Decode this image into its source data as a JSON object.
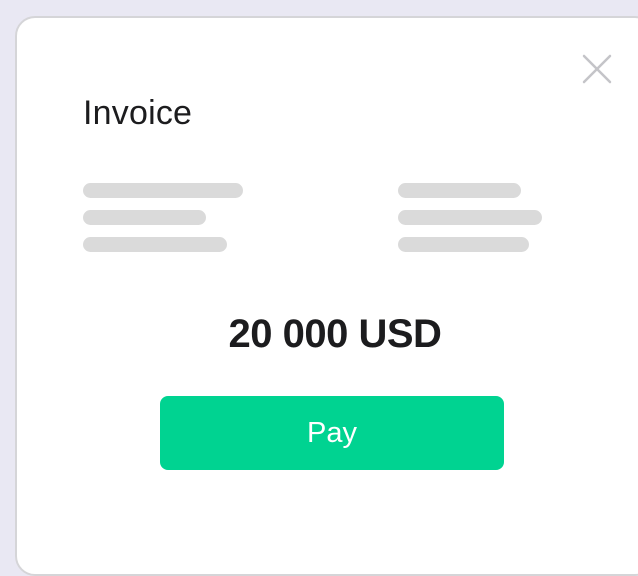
{
  "dialog": {
    "title": "Invoice",
    "close_icon": "close-icon",
    "amount": "20 000 USD",
    "pay_label": "Pay"
  },
  "colors": {
    "background": "#e9e8f3",
    "card": "#ffffff",
    "accent": "#00d391",
    "skeleton": "#dadada",
    "text": "#1c1c1e"
  }
}
